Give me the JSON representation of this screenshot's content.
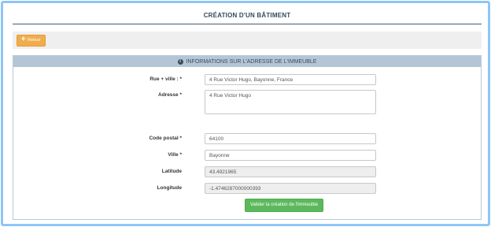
{
  "page": {
    "title": "CRÉATION D'UN BÂTIMENT"
  },
  "toolbar": {
    "back_icon": "arrow-left-icon",
    "back_label": "Retour"
  },
  "panel": {
    "icon": "info-circle-icon",
    "title": "INFORMATIONS SUR L'ADRESSE DE L'IMMEUBLE"
  },
  "form": {
    "street_city": {
      "label": "Rue + ville : *",
      "value": "4 Rue Victor Hugo, Bayonne, France"
    },
    "address": {
      "label": "Adresse *",
      "value": "4 Rue Victor Hugo"
    },
    "postal_code": {
      "label": "Code postal *",
      "value": "64100"
    },
    "city": {
      "label": "Ville *",
      "value": "Bayonne"
    },
    "latitude": {
      "label": "Latitude",
      "value": "43.4921965"
    },
    "longitude": {
      "label": "Longitude",
      "value": "-1.4746287000000393"
    },
    "submit_label": "Valider la création de l'immeuble"
  },
  "colors": {
    "frame_border": "#8ec5f5",
    "back_button": "#f0ad4e",
    "panel_header": "#b4c6d6",
    "submit_button": "#5cb85c"
  }
}
